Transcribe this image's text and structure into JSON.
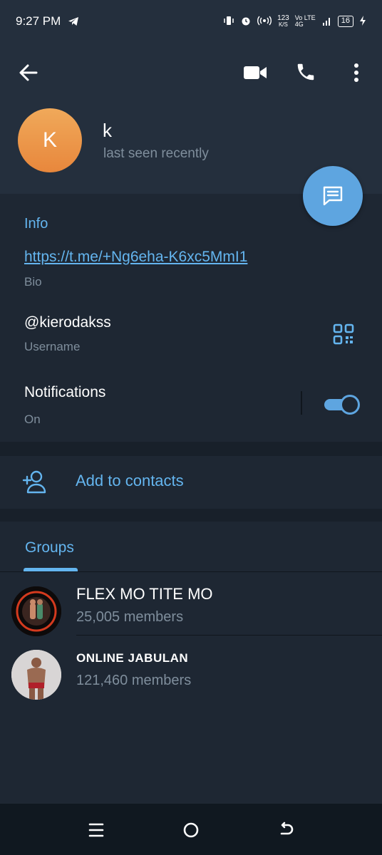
{
  "status_bar": {
    "time": "9:27 PM",
    "net_speed_value": "123",
    "net_speed_unit": "K/S",
    "network_labels": "Vo LTE 4G",
    "battery": "16",
    "icons": [
      "telegram-icon",
      "vibrate-icon",
      "alarm-icon",
      "hotspot-icon",
      "signal-icon",
      "battery-icon",
      "charging-icon"
    ]
  },
  "header": {
    "avatar_letter": "K",
    "name": "k",
    "status": "last seen recently",
    "avatar_color": "#eb9a4c",
    "icons": [
      "back-arrow-icon",
      "video-call-icon",
      "phone-icon",
      "more-vertical-icon"
    ]
  },
  "fab": {
    "icon": "message-icon",
    "color": "#5ea5e0"
  },
  "info": {
    "title": "Info",
    "bio_link": "https://t.me/+Ng6eha-K6xc5MmI1",
    "bio_label": "Bio",
    "username": "@kierodakss",
    "username_label": "Username",
    "notifications_title": "Notifications",
    "notifications_state": "On",
    "notifications_enabled": true
  },
  "actions": {
    "add_to_contacts": "Add to contacts"
  },
  "groups_tab": {
    "label": "Groups",
    "items": [
      {
        "name": "FLEX MO TITE MO",
        "members": "25,005 members"
      },
      {
        "name": "ONLINE JABULAN",
        "members": "121,460 members"
      }
    ]
  },
  "nav": {
    "icons": [
      "menu-icon",
      "home-icon",
      "back-icon"
    ]
  },
  "colors": {
    "accent": "#64b5ef",
    "background": "#17212b",
    "header": "#242f3d",
    "section": "#1e2733",
    "secondary_text": "#7f8e9c"
  }
}
